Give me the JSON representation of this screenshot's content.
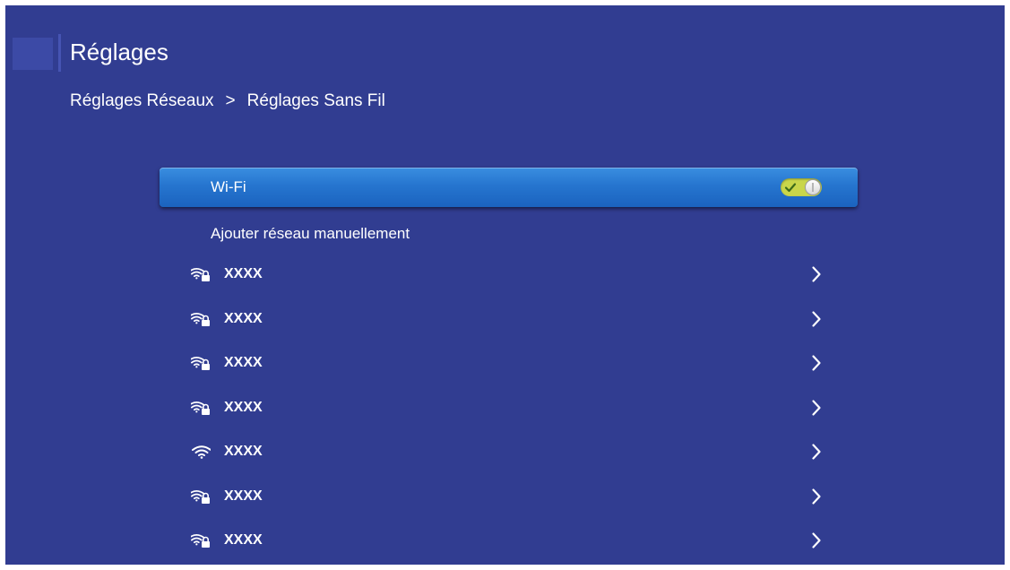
{
  "header": {
    "title": "Réglages"
  },
  "breadcrumb": {
    "parent": "Réglages Réseaux",
    "separator": ">",
    "current": "Réglages Sans Fil"
  },
  "wifi": {
    "label": "Wi-Fi",
    "enabled": true,
    "toggle_color": "#c9d64a"
  },
  "add_network": {
    "label": "Ajouter réseau manuellement"
  },
  "networks": [
    {
      "name": "XXXX",
      "icon": "wifi-lock-icon",
      "secured": true
    },
    {
      "name": "XXXX",
      "icon": "wifi-lock-icon",
      "secured": true
    },
    {
      "name": "XXXX",
      "icon": "wifi-lock-icon",
      "secured": true
    },
    {
      "name": "XXXX",
      "icon": "wifi-lock-icon",
      "secured": true
    },
    {
      "name": "XXXX",
      "icon": "wifi-icon",
      "secured": false
    },
    {
      "name": "XXXX",
      "icon": "wifi-lock-icon",
      "secured": true
    },
    {
      "name": "XXXX",
      "icon": "wifi-lock-icon",
      "secured": true
    }
  ],
  "colors": {
    "background": "#313d91",
    "highlight": "#2675cf",
    "text": "#ffffff"
  }
}
